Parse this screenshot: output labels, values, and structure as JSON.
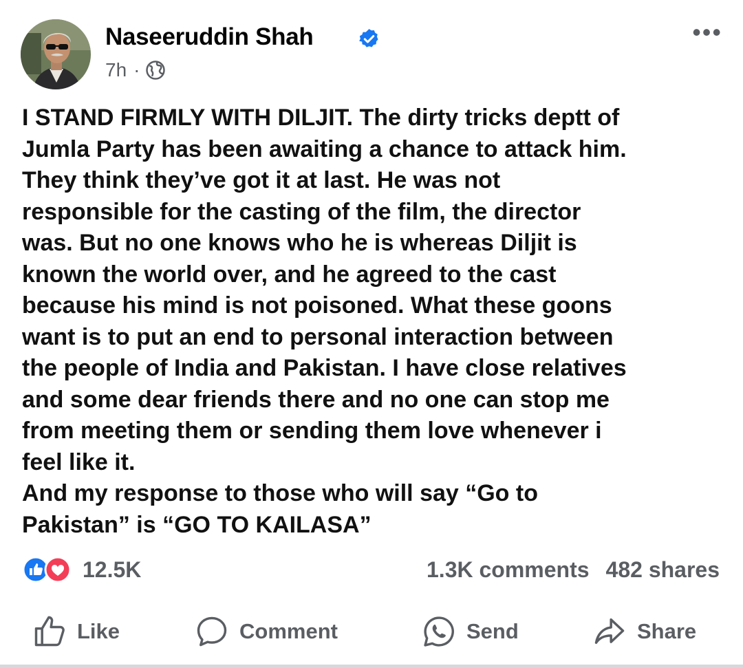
{
  "author": {
    "name": "Naseeruddin Shah",
    "verified": true,
    "time": "7h",
    "separator": "·",
    "visibility_icon": "globe-icon"
  },
  "post": {
    "lines": [
      "I STAND FIRMLY WITH DILJIT. The dirty tricks deptt of",
      "Jumla Party has been awaiting a chance to attack him.",
      "They think they’ve got it at last. He was not",
      "responsible for the casting of the film, the director",
      "was. But no one knows who he is whereas Diljit is",
      "known the world over, and he agreed to the cast",
      "because his mind is not poisoned. What these goons",
      "want is to put an end to personal interaction between",
      "the people of India and Pakistan. I have close relatives",
      "and some dear friends there and no one can stop me",
      "from meeting them or sending them love whenever i",
      "feel like it.",
      "And my response to  those who will say “Go to",
      "Pakistan” is “GO TO KAILASA”"
    ]
  },
  "reactions": {
    "icons": [
      "like-icon",
      "love-icon"
    ],
    "count": "12.5K"
  },
  "stats": {
    "comments": "1.3K comments",
    "shares": "482 shares"
  },
  "actions": {
    "like": "Like",
    "comment": "Comment",
    "send": "Send",
    "share": "Share"
  },
  "colors": {
    "text": "#050505",
    "secondary": "#5a5e63",
    "facebook_blue": "#1877f2",
    "love_red": "#f33e58"
  }
}
